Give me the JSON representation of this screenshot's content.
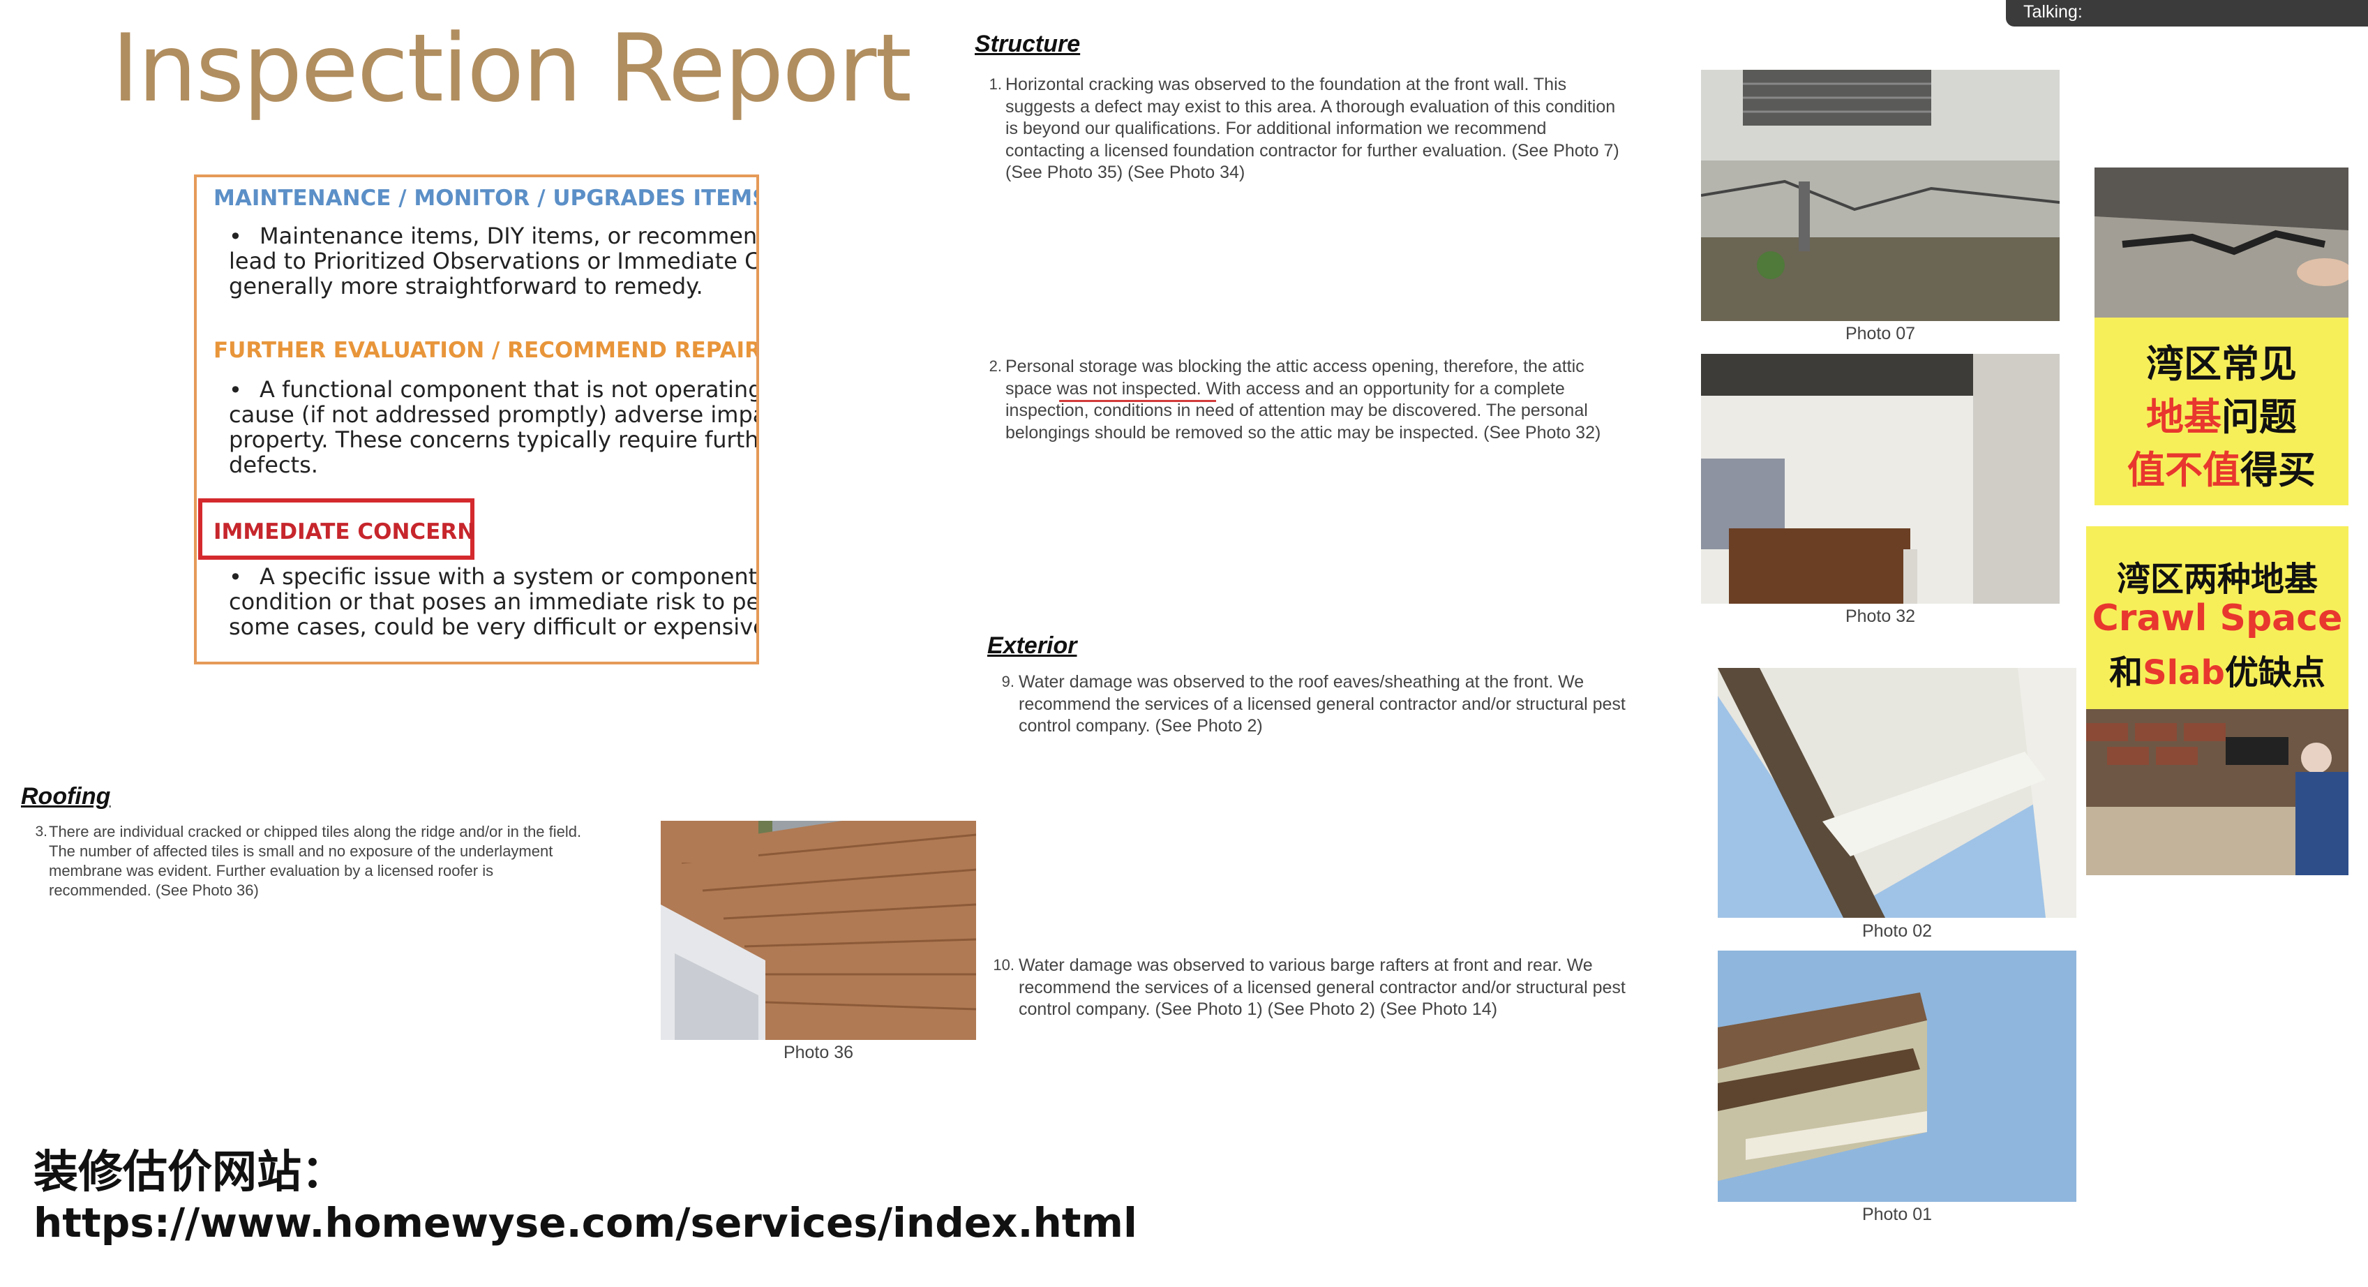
{
  "title": "Inspection Report",
  "talking_label": "Talking:",
  "legend": {
    "maintenance_heading": "MAINTENANCE / MONITOR / UPGRADES ITEMS",
    "maintenance_text": "Maintenance items, DIY items, or recommende\nlead to Prioritized Observations or Immediate Cor\ngenerally more straightforward to remedy.",
    "further_heading": "FURTHER EVALUATION / RECOMMEND REPAIR",
    "further_text": "A functional component that is not operating a\ncause (if not addressed promptly) adverse impact\nproperty. These concerns typically require further\ndefects.",
    "immediate_heading": "IMMEDIATE CONCERN",
    "immediate_text": "A specific issue with a system or component th\ncondition or that poses an immediate risk to peop\nsome cases, could be very difficult or expensive to",
    "bullet": "•"
  },
  "structure": {
    "heading": "Structure",
    "item1_num": "1.",
    "item1_text": "Horizontal cracking was observed to the foundation at the front wall. This\nsuggests a defect may exist to this area. A thorough evaluation of this condition\nis beyond our qualifications. For additional information we recommend\ncontacting a licensed foundation contractor for further evaluation. (See Photo 7)\n(See Photo 35) (See Photo 34)",
    "item2_num": "2.",
    "item2_text": "Personal storage was blocking the attic access opening, therefore, the attic\nspace was not inspected. With access and an opportunity for a complete\ninspection, conditions in need of attention may be discovered. The personal\nbelongings should be removed so the attic may be inspected. (See Photo 32)",
    "photo07_caption": "Photo 07",
    "photo32_caption": "Photo 32"
  },
  "exterior": {
    "heading": "Exterior",
    "item9_num": "9.",
    "item9_text": "Water damage was observed to the roof eaves/sheathing at the front. We\nrecommend the services of a licensed general contractor and/or structural pest\ncontrol company. (See Photo 2)",
    "item10_num": "10.",
    "item10_text": "Water damage was observed to various barge rafters at front and rear. We\nrecommend the services of a licensed general contractor and/or structural pest\ncontrol company. (See Photo 1) (See Photo 2) (See Photo 14)",
    "photo02_caption": "Photo 02",
    "photo01_caption": "Photo 01"
  },
  "roofing": {
    "heading": "Roofing",
    "item3_num": "3.",
    "item3_text": "There are individual cracked or chipped tiles along the ridge and/or in the field.\nThe number of affected tiles is small and no exposure of the underlayment\nmembrane was evident. Further evaluation by a licensed roofer is\nrecommended. (See Photo 36)",
    "photo36_caption": "Photo 36"
  },
  "thumb1": {
    "line1": "湾区常见",
    "line2_red": "地基",
    "line2_black": "问题",
    "line3_red": "值不值",
    "line3_black": "得买"
  },
  "thumb2": {
    "line1": "湾区两种地基",
    "line2": "Crawl Space",
    "line3_a": "和",
    "line3_b": "Slab",
    "line3_c": "优缺点"
  },
  "overlay": {
    "label": "装修估价网站：",
    "url": "https://www.homewyse.com/services/index.html"
  },
  "colors": {
    "title": "#b18e5f",
    "legend_border": "#e59a58",
    "maintenance": "#5b8fc7",
    "further": "#e8953a",
    "immediate": "#c6262c",
    "thumb_yellow": "#f7ef5a",
    "thumb_red": "#e8372e"
  }
}
